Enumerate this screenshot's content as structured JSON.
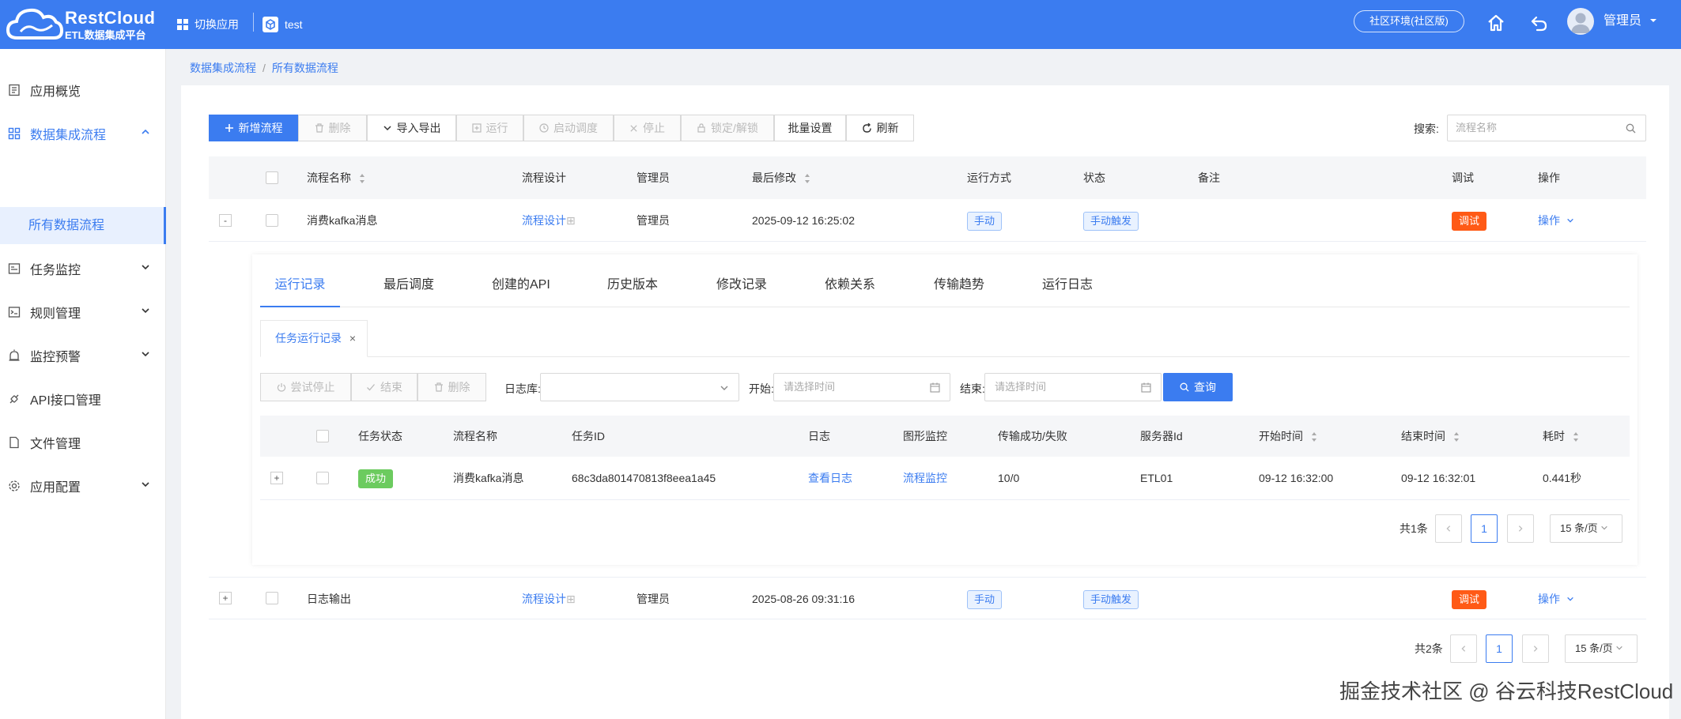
{
  "header": {
    "logo_title": "RestCloud",
    "logo_subtitle": "ETL数据集成平台",
    "switch_app": "切换应用",
    "app_name": "test",
    "env_label": "社区环境(社区版)",
    "user": "管理员",
    "icons": [
      "grid-icon",
      "cube-icon",
      "home-icon",
      "back-icon",
      "avatar-icon",
      "caret-down-icon"
    ]
  },
  "sidebar": {
    "items": [
      {
        "label": "应用概览",
        "icon": "overview-icon"
      },
      {
        "label": "数据集成流程",
        "icon": "apps-icon",
        "expanded": true
      },
      {
        "label": "任务监控",
        "icon": "monitor-icon"
      },
      {
        "label": "规则管理",
        "icon": "rule-icon"
      },
      {
        "label": "监控预警",
        "icon": "alarm-icon"
      },
      {
        "label": "API接口管理",
        "icon": "api-icon"
      },
      {
        "label": "文件管理",
        "icon": "file-icon"
      },
      {
        "label": "应用配置",
        "icon": "settings-icon"
      }
    ],
    "sub_item": "所有数据流程"
  },
  "breadcrumb": {
    "first": "数据集成流程",
    "sep": "/",
    "second": "所有数据流程"
  },
  "toolbar": {
    "add": "新增流程",
    "delete": "删除",
    "import_export": "导入导出",
    "run": "运行",
    "start_schedule": "启动调度",
    "stop": "停止",
    "lock": "锁定/解锁",
    "batch": "批量设置",
    "refresh": "刷新",
    "search_label": "搜索:",
    "search_placeholder": "流程名称"
  },
  "table": {
    "columns": {
      "name": "流程名称",
      "design": "流程设计",
      "admin": "管理员",
      "modified": "最后修改",
      "run_mode": "运行方式",
      "status": "状态",
      "note": "备注",
      "debug": "调试",
      "ops": "操作"
    },
    "rows": [
      {
        "expand": "-",
        "name": "消费kafka消息",
        "design": "流程设计",
        "design_suffix": "⊞",
        "admin": "管理员",
        "modified": "2025-09-12 16:25:02",
        "run_mode": "手动",
        "status": "手动触发",
        "debug": "调试",
        "ops": "操作"
      },
      {
        "expand": "+",
        "name": "日志输出",
        "design": "流程设计",
        "design_suffix": "⊞",
        "admin": "管理员",
        "modified": "2025-08-26 09:31:16",
        "run_mode": "手动",
        "status": "手动触发",
        "debug": "调试",
        "ops": "操作"
      }
    ],
    "pager": {
      "total": "共2条",
      "page": "1",
      "size": "15 条/页"
    }
  },
  "detail": {
    "tabs": [
      "运行记录",
      "最后调度",
      "创建的API",
      "历史版本",
      "修改记录",
      "依赖关系",
      "传输趋势",
      "运行日志"
    ],
    "subtab": "任务运行记录",
    "subtab_close": "×",
    "actions": {
      "try_stop": "尝试停止",
      "end": "结束",
      "delete": "删除"
    },
    "filters": {
      "db_label": "日志库:",
      "start_label": "开始:",
      "start_placeholder": "请选择时间",
      "end_label": "结束:",
      "end_placeholder": "请选择时间",
      "query": "查询"
    },
    "columns": {
      "status": "任务状态",
      "name": "流程名称",
      "task_id": "任务ID",
      "log": "日志",
      "graph": "图形监控",
      "transfer": "传输成功/失败",
      "server": "服务器Id",
      "start": "开始时间",
      "end": "结束时间",
      "cost": "耗时"
    },
    "row": {
      "expand": "+",
      "status": "成功",
      "name": "消费kafka消息",
      "task_id": "68c3da801470813f8eea1a45",
      "log": "查看日志",
      "graph": "流程监控",
      "transfer": "10/0",
      "server": "ETL01",
      "start": "09-12 16:32:00",
      "end": "09-12 16:32:01",
      "cost": "0.441秒"
    },
    "pager": {
      "total": "共1条",
      "page": "1",
      "size": "15 条/页"
    }
  },
  "watermark": "掘金技术社区 @ 谷云科技RestCloud"
}
